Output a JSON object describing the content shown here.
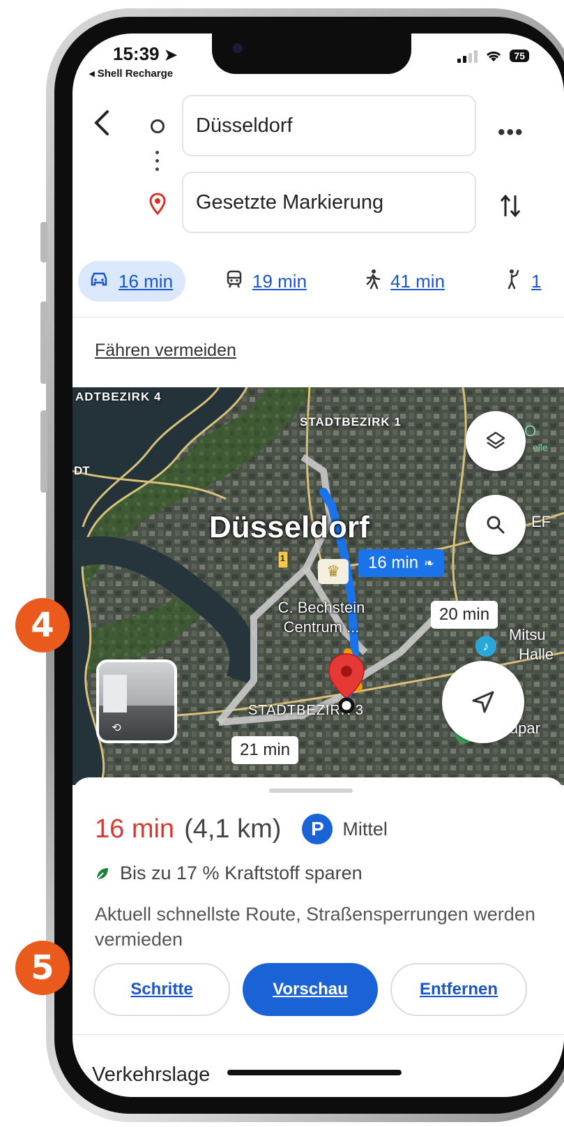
{
  "status_bar": {
    "time": "15:39",
    "back_app": "◂ Shell Recharge",
    "battery": "75"
  },
  "directions": {
    "origin": "Düsseldorf",
    "destination": "Gesetzte Markierung"
  },
  "modes": [
    {
      "icon": "car-icon",
      "label": "16 min"
    },
    {
      "icon": "transit-icon",
      "label": "19 min"
    },
    {
      "icon": "walk-icon",
      "label": "41 min"
    },
    {
      "icon": "ride-icon",
      "label": "1"
    }
  ],
  "avoid_link": "Fähren vermeiden",
  "map": {
    "labels": {
      "district4": "ADTBEZIRK 4",
      "district1": "STADTBEZIRK 1",
      "city": "Düsseldorf",
      "poi": "C. Bechstein Centrum ...",
      "district3": "STADTBEZIRK 3",
      "left_fragment": "DT",
      "right_fragment1": "O",
      "right_fragment1b": "elle",
      "right_fragment2": "EF",
      "mitsu": "Mitsu",
      "halle": "Halle",
      "sudpark": "Südpar",
      "road_badge": "1"
    },
    "route_labels": {
      "main": "16 min",
      "alt1": "20 min",
      "alt2": "21 min"
    }
  },
  "route_summary": {
    "time": "16 min",
    "distance": "(4,1 km)",
    "parking_icon": "P",
    "parking_text": "Mittel",
    "fuel_text": "Bis zu 17 % Kraftstoff sparen",
    "description": "Aktuell schnellste Route, Straßensperrungen werden vermieden"
  },
  "buttons": {
    "steps": "Schritte",
    "preview": "Vorschau",
    "remove": "Entfernen"
  },
  "traffic_heading": "Verkehrslage",
  "annotations": {
    "badge_4": "4",
    "badge_5": "5"
  },
  "colors": {
    "route_blue": "#1a73e8",
    "time_red": "#d63a2f",
    "parking_blue": "#1a63d6",
    "badge_orange": "#ea5a1d",
    "pin_red": "#e53935"
  }
}
